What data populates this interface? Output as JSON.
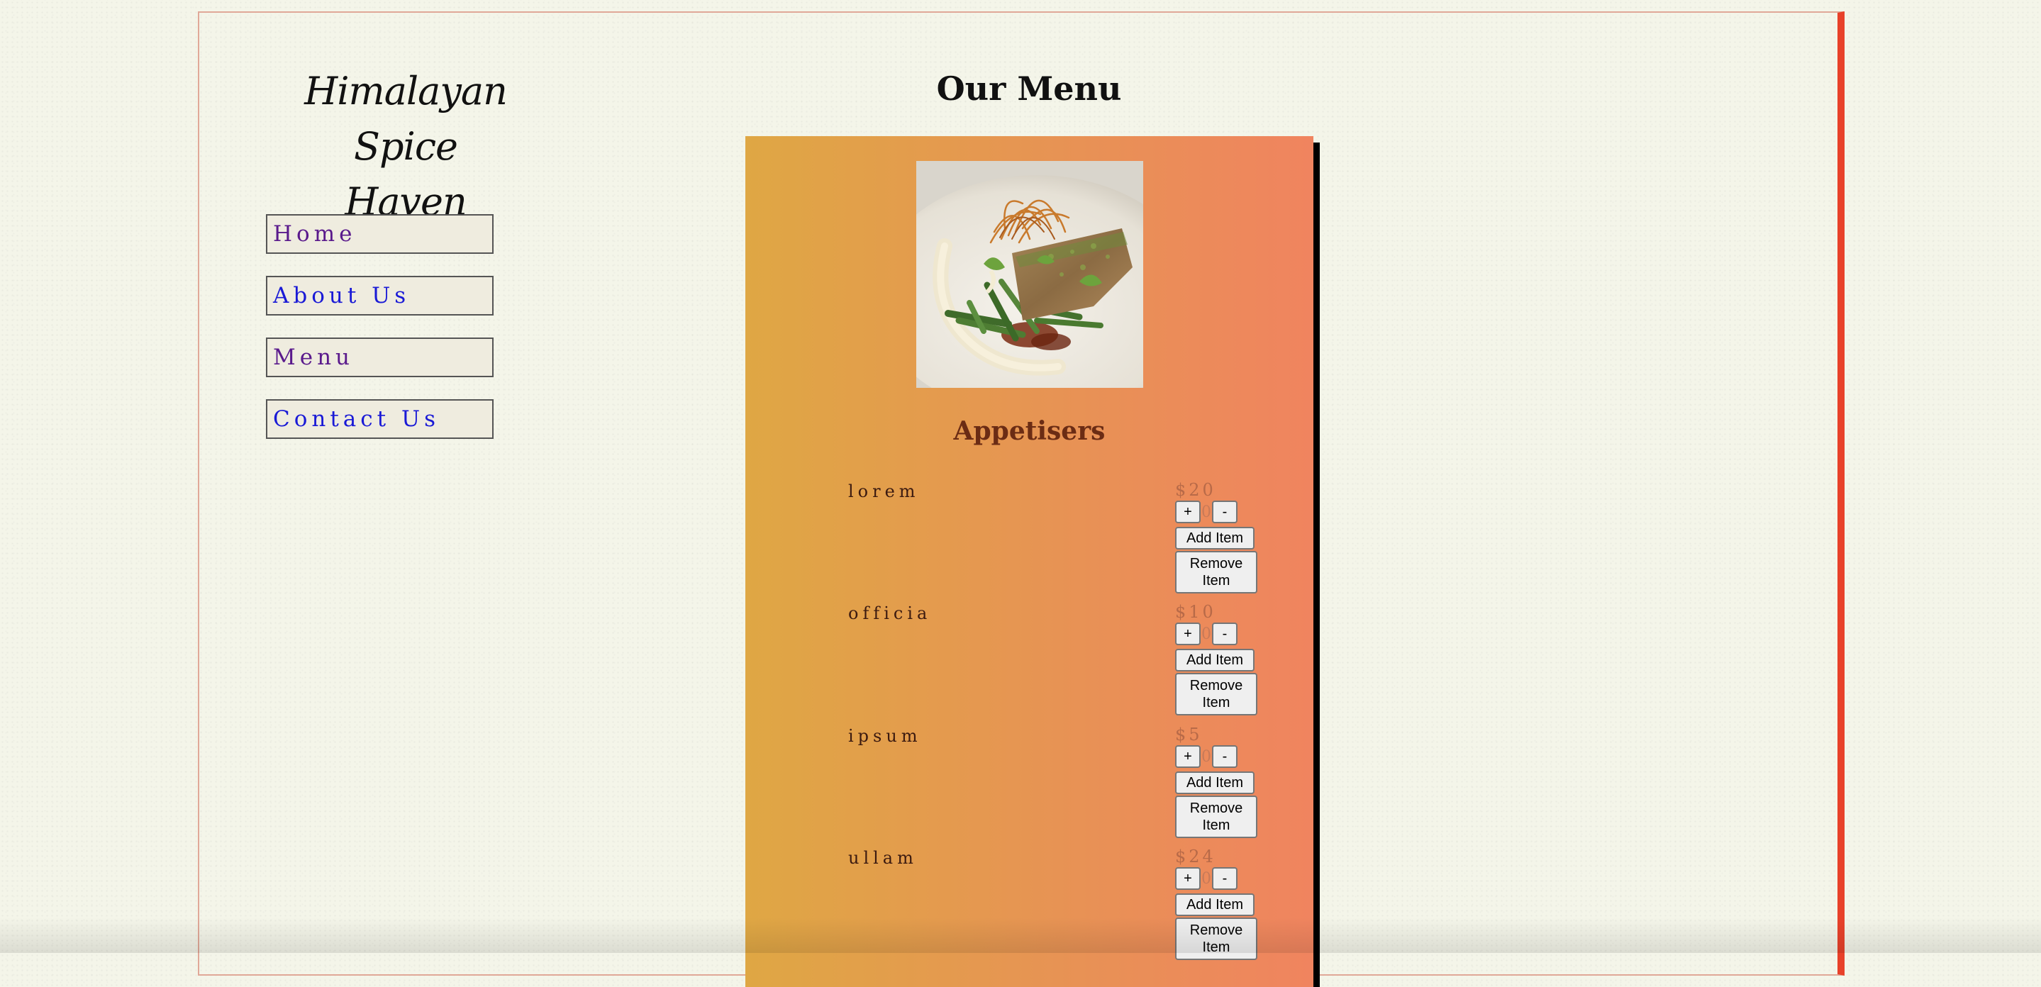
{
  "site": {
    "title_line1": "Himalayan Spice",
    "title_line2": "Haven"
  },
  "nav": {
    "items": [
      {
        "label": "Home",
        "visited": true
      },
      {
        "label": "About Us",
        "visited": false
      },
      {
        "label": "Menu",
        "visited": true
      },
      {
        "label": "Contact Us",
        "visited": false
      }
    ]
  },
  "menu": {
    "heading": "Our Menu",
    "image_alt": "plated fish with green beans and crispy garnish",
    "section": "Appetisers",
    "items": [
      {
        "name": "lorem",
        "price": "$20",
        "qty": "0"
      },
      {
        "name": "officia",
        "price": "$10",
        "qty": "0"
      },
      {
        "name": "ipsum",
        "price": "$5",
        "qty": "0"
      },
      {
        "name": "ullam",
        "price": "$24",
        "qty": "0"
      }
    ],
    "labels": {
      "plus": "+",
      "minus": "-",
      "add": "Add Item",
      "remove": "Remove Item"
    }
  },
  "colors": {
    "frame_accent": "#e8412a",
    "card_gradient_start": "#dfa744",
    "card_gradient_end": "#f0845f",
    "visited_link": "#5a1a8c",
    "link": "#1a1ad6"
  }
}
